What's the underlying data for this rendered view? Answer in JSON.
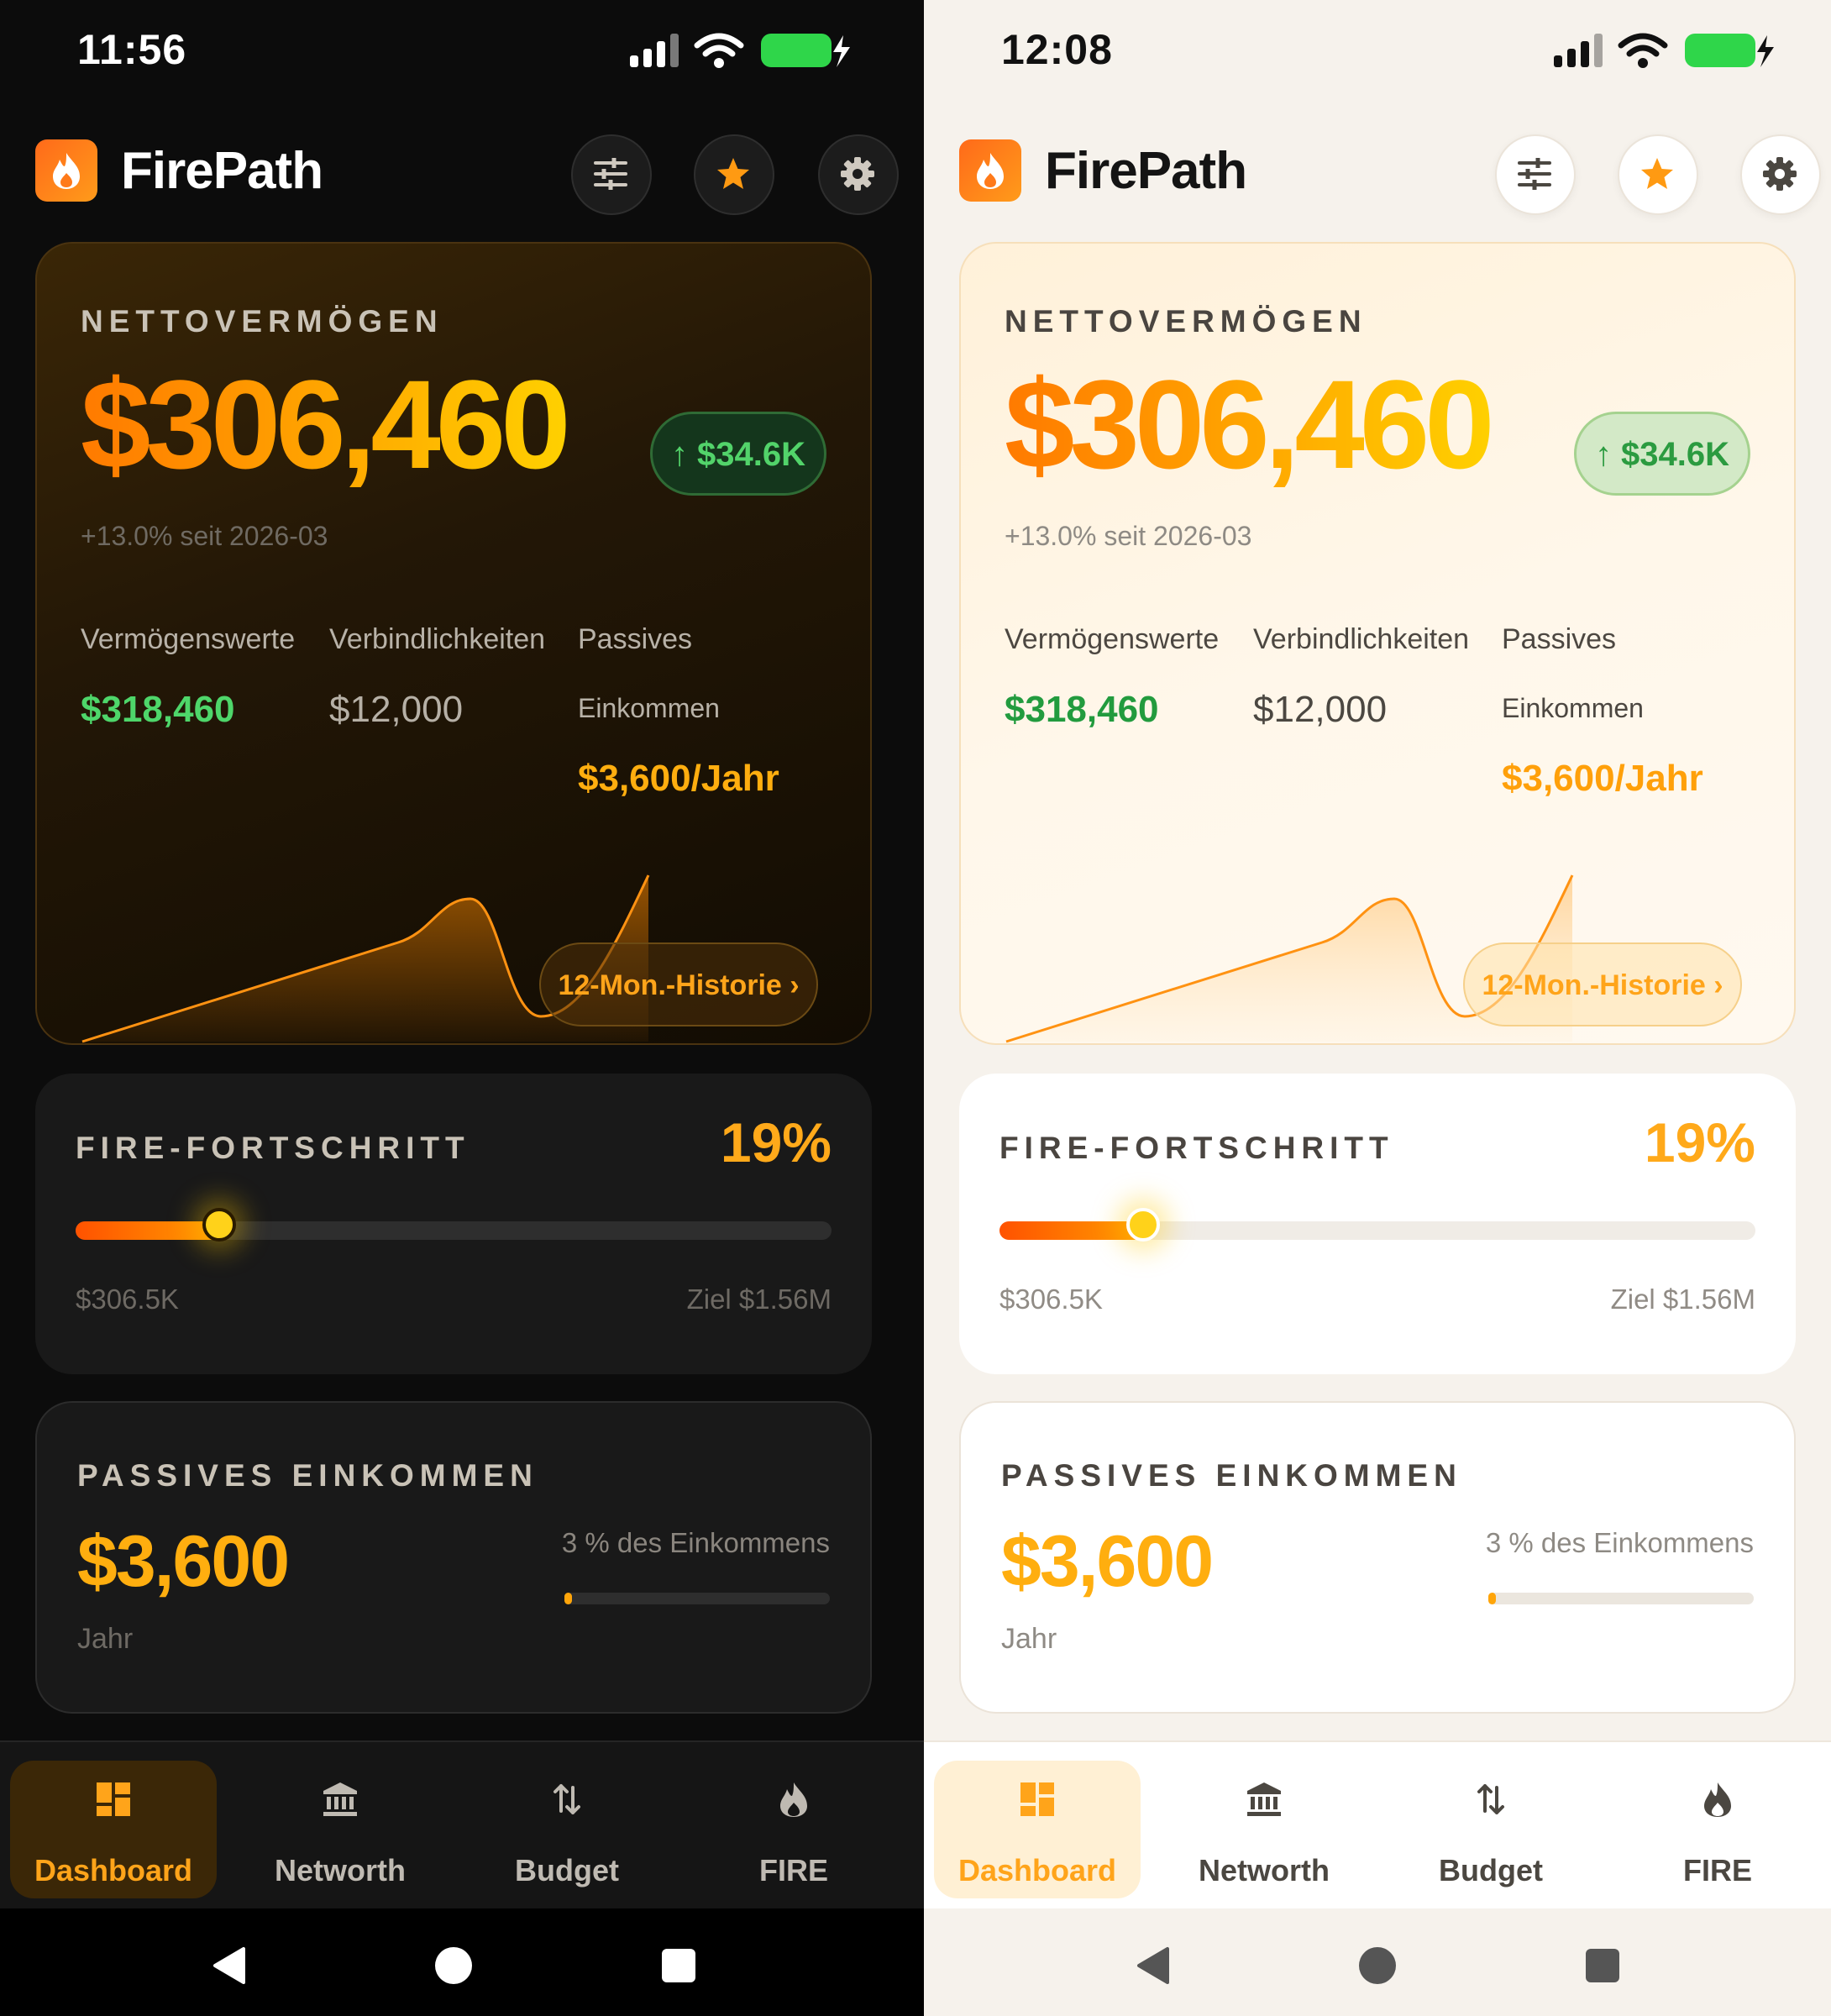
{
  "screens": [
    {
      "theme": "dark",
      "status_time": "11:56",
      "brand": "FirePath",
      "net_worth": {
        "label": "NETTOVERMÖGEN",
        "value": "$306,460",
        "change": "↑ $34.6K",
        "since": "+13.0% seit 2026-03",
        "assets_label": "Vermögenswerte",
        "assets_value": "$318,460",
        "liabilities_label": "Verbindlichkeiten",
        "liabilities_value": "$12,000",
        "passive_label_1": "Passives",
        "passive_label_2": "Einkommen",
        "passive_value": "$3,600/Jahr",
        "history_button": "12-Mon.-Historie ›"
      },
      "fire": {
        "label": "FIRE-FORTSCHRITT",
        "percent_label": "19%",
        "progress": 0.19,
        "current": "$306.5K",
        "target": "Ziel $1.56M"
      },
      "passive": {
        "label": "PASSIVES EINKOMMEN",
        "value": "$3,600",
        "share": "3 % des Einkommens",
        "share_fraction": 0.03,
        "period": "Jahr"
      },
      "nav": [
        "Dashboard",
        "Networth",
        "Budget",
        "FIRE"
      ]
    },
    {
      "theme": "light",
      "status_time": "12:08",
      "brand": "FirePath",
      "net_worth": {
        "label": "NETTOVERMÖGEN",
        "value": "$306,460",
        "change": "↑ $34.6K",
        "since": "+13.0% seit 2026-03",
        "assets_label": "Vermögenswerte",
        "assets_value": "$318,460",
        "liabilities_label": "Verbindlichkeiten",
        "liabilities_value": "$12,000",
        "passive_label_1": "Passives",
        "passive_label_2": "Einkommen",
        "passive_value": "$3,600/Jahr",
        "history_button": "12-Mon.-Historie ›"
      },
      "fire": {
        "label": "FIRE-FORTSCHRITT",
        "percent_label": "19%",
        "progress": 0.19,
        "current": "$306.5K",
        "target": "Ziel $1.56M"
      },
      "passive": {
        "label": "PASSIVES EINKOMMEN",
        "value": "$3,600",
        "share": "3 % des Einkommens",
        "share_fraction": 0.03,
        "period": "Jahr"
      },
      "nav": [
        "Dashboard",
        "Networth",
        "Budget",
        "FIRE"
      ]
    }
  ],
  "icons": {
    "header": [
      "sliders-icon",
      "star-icon",
      "gear-icon"
    ],
    "nav": [
      "dashboard-icon",
      "bank-icon",
      "transfer-arrows-icon",
      "flame-icon"
    ],
    "status": [
      "signal-icon",
      "wifi-icon",
      "battery-charging-icon"
    ]
  },
  "colors": {
    "accent": "#ffa41a",
    "gradient_start": "#ff7a00",
    "gradient_end": "#ffd000",
    "positive": "#4ed66a",
    "battery": "#2fd64a"
  }
}
